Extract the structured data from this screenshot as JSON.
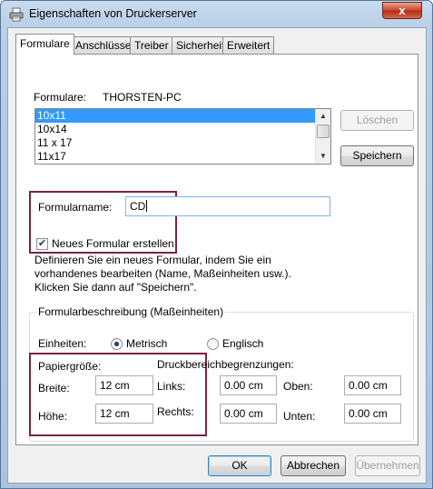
{
  "window": {
    "title": "Eigenschaften von Druckerserver",
    "close_glyph": "x"
  },
  "tabs": [
    "Formulare",
    "Anschlüsse",
    "Treiber",
    "Sicherheit",
    "Erweitert"
  ],
  "forms": {
    "label": "Formulare:",
    "server": "THORSTEN-PC",
    "list": [
      "10x11",
      "10x14",
      "11 x 17",
      "11x17"
    ],
    "selected": "10x11"
  },
  "buttons": {
    "delete": "Löschen",
    "save": "Speichern",
    "ok": "OK",
    "cancel": "Abbrechen",
    "apply": "Übernehmen"
  },
  "form_name": {
    "label": "Formularname:",
    "value": "CD"
  },
  "new_form": {
    "label": "Neues Formular erstellen",
    "checked": true,
    "desc_lines": [
      "Definieren Sie ein neues Formular, indem Sie ein",
      "vorhandenes bearbeiten (Name, Maßeinheiten usw.).",
      "Klicken Sie dann auf \"Speichern\"."
    ]
  },
  "description": {
    "title": "Formularbeschreibung (Maßeinheiten)",
    "units_label": "Einheiten:",
    "metric": "Metrisch",
    "english": "Englisch",
    "selected_unit": "Metrisch",
    "paper_size": "Papiergröße:",
    "width_label": "Breite:",
    "width_value": "12 cm",
    "height_label": "Höhe:",
    "height_value": "12 cm",
    "margins_label": "Druckbereichbegrenzungen:",
    "left_label": "Links:",
    "left_value": "0.00 cm",
    "right_label": "Rechts:",
    "right_value": "0.00 cm",
    "top_label": "Oben:",
    "top_value": "0.00 cm",
    "bottom_label": "Unten:",
    "bottom_value": "0.00 cm"
  },
  "colors": {
    "accent": "#3399ff",
    "highlight_box": "#7d2247"
  }
}
